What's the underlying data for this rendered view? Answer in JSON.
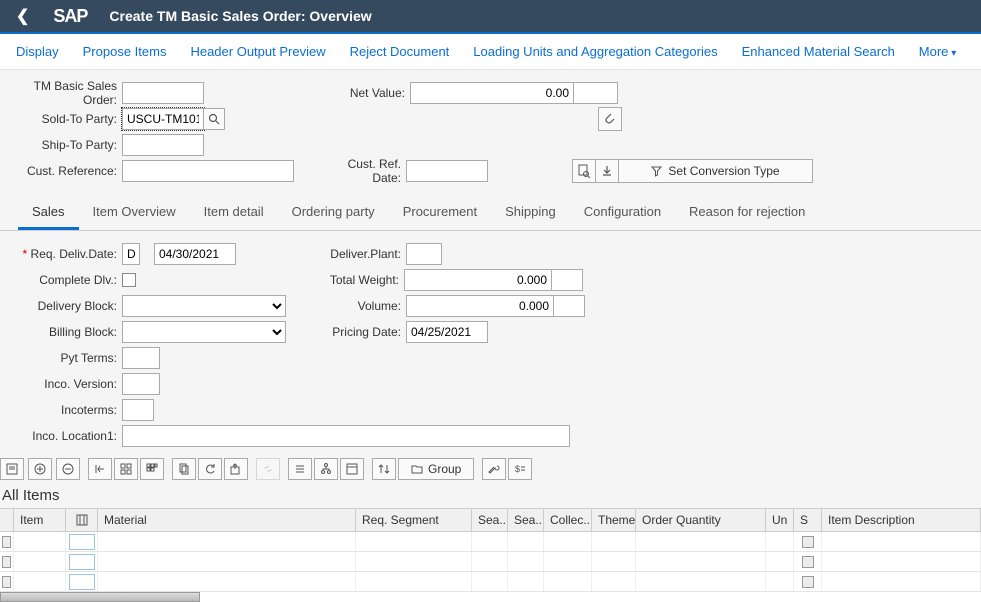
{
  "header": {
    "title": "Create TM Basic Sales Order: Overview"
  },
  "toolbar": {
    "display": "Display",
    "propose": "Propose Items",
    "header_output": "Header Output Preview",
    "reject": "Reject Document",
    "loading": "Loading Units and Aggregation Categories",
    "enhanced": "Enhanced Material Search",
    "more": "More"
  },
  "form": {
    "labels": {
      "order": "TM Basic Sales Order:",
      "netvalue": "Net Value:",
      "soldto": "Sold-To Party:",
      "shipto": "Ship-To Party:",
      "custref": "Cust. Reference:",
      "custrefdate": "Cust. Ref. Date:",
      "convtype": "Set Conversion Type"
    },
    "values": {
      "order": "",
      "netvalue": "0.00",
      "netvalue_curr": "",
      "soldto": "USCU-TM101",
      "shipto": "",
      "custref": "",
      "custrefdate": ""
    }
  },
  "tabs": {
    "sales": "Sales",
    "item_overview": "Item Overview",
    "item_detail": "Item detail",
    "ordering": "Ordering party",
    "procurement": "Procurement",
    "shipping": "Shipping",
    "config": "Configuration",
    "reason": "Reason for rejection"
  },
  "sales": {
    "labels": {
      "reqdeliv": "Req. Deliv.Date:",
      "delivplant": "Deliver.Plant:",
      "complete": "Complete Dlv.:",
      "totalweight": "Total Weight:",
      "delivblock": "Delivery Block:",
      "volume": "Volume:",
      "billblock": "Billing Block:",
      "pricingdate": "Pricing Date:",
      "pytterms": "Pyt Terms:",
      "incoversion": "Inco. Version:",
      "incoterms": "Incoterms:",
      "incolocation": "Inco. Location1:"
    },
    "values": {
      "reqdeliv_type": "D",
      "reqdeliv_date": "04/30/2021",
      "delivplant": "",
      "totalweight": "0.000",
      "totalweight_u": "",
      "volume": "0.000",
      "volume_u": "",
      "pricingdate": "04/25/2021",
      "pytterms": "",
      "incoversion": "",
      "incoterms": "",
      "incolocation": ""
    }
  },
  "grouptoolbar": {
    "group": "Group"
  },
  "items": {
    "title": "All Items",
    "cols": {
      "item": "Item",
      "material": "Material",
      "reqseg": "Req. Segment",
      "sea1": "Sea...",
      "sea2": "Sea...",
      "collec": "Collec...",
      "theme": "Theme",
      "orderqty": "Order Quantity",
      "un": "Un",
      "s": "S",
      "desc": "Item Description"
    }
  }
}
